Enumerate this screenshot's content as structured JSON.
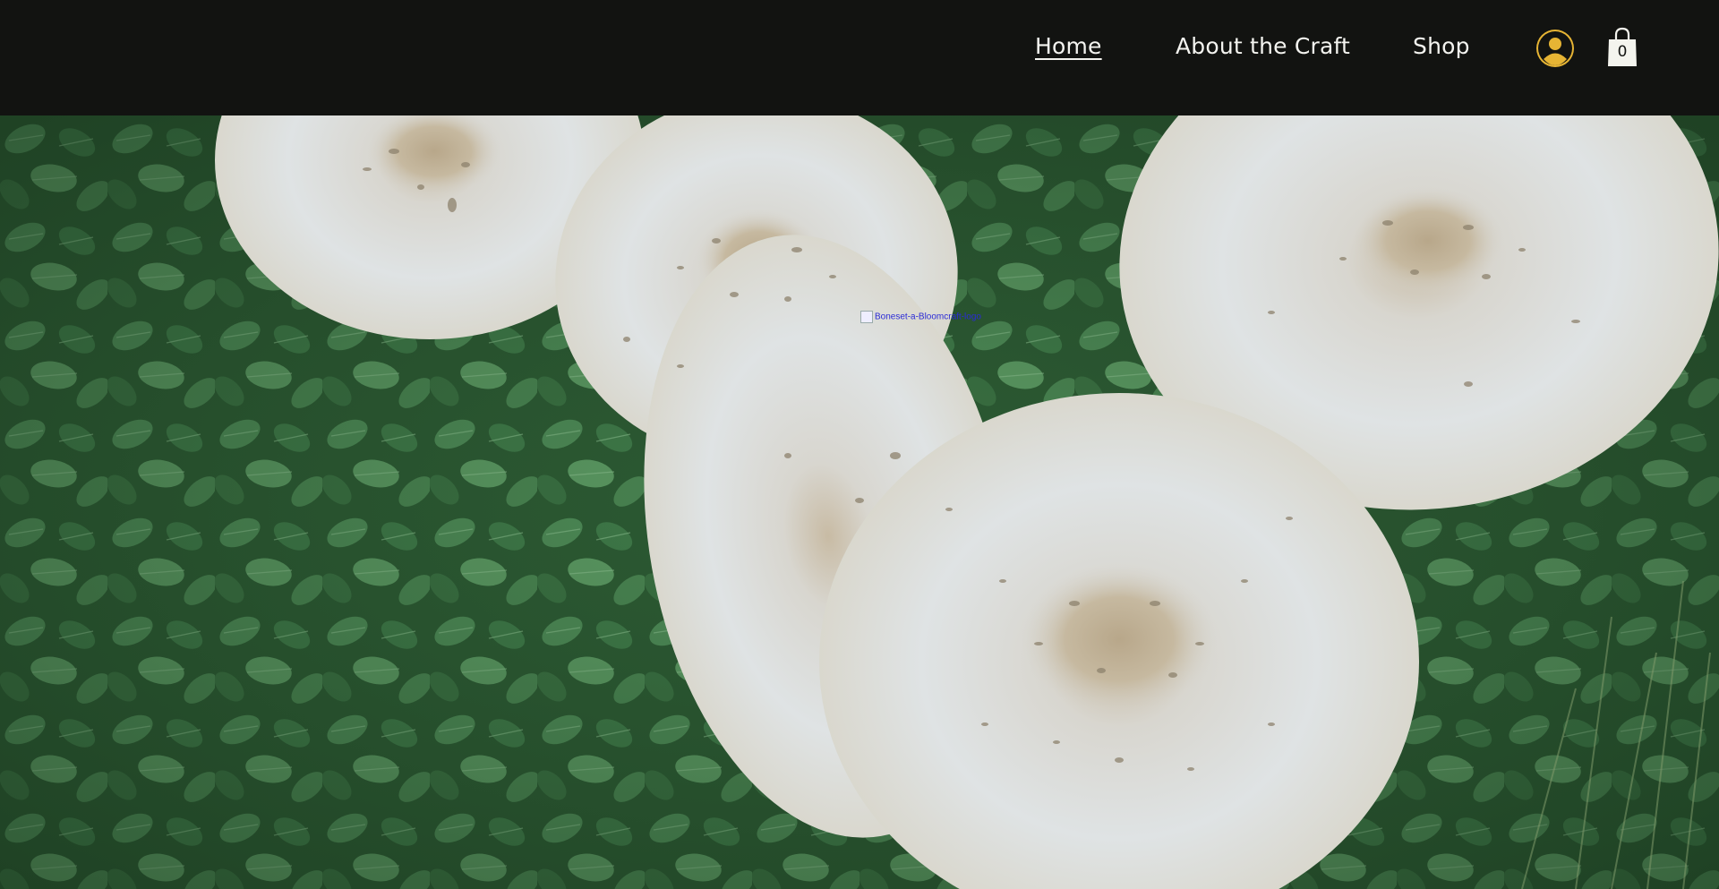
{
  "header": {
    "nav": [
      {
        "label": "Home",
        "active": true
      },
      {
        "label": "About the Craft",
        "active": false
      },
      {
        "label": "Shop",
        "active": false
      }
    ],
    "login_icon": "user-avatar-icon",
    "cart_icon": "shopping-bag-icon",
    "cart_count": "0",
    "colors": {
      "header_bg": "#121311",
      "nav_text": "#f4f4f0",
      "avatar": "#e6b434"
    }
  },
  "hero": {
    "logo_alt_text": "Boneset-a-Bloomcraft-logo",
    "image_subject": "mushrooms-in-leaves"
  }
}
